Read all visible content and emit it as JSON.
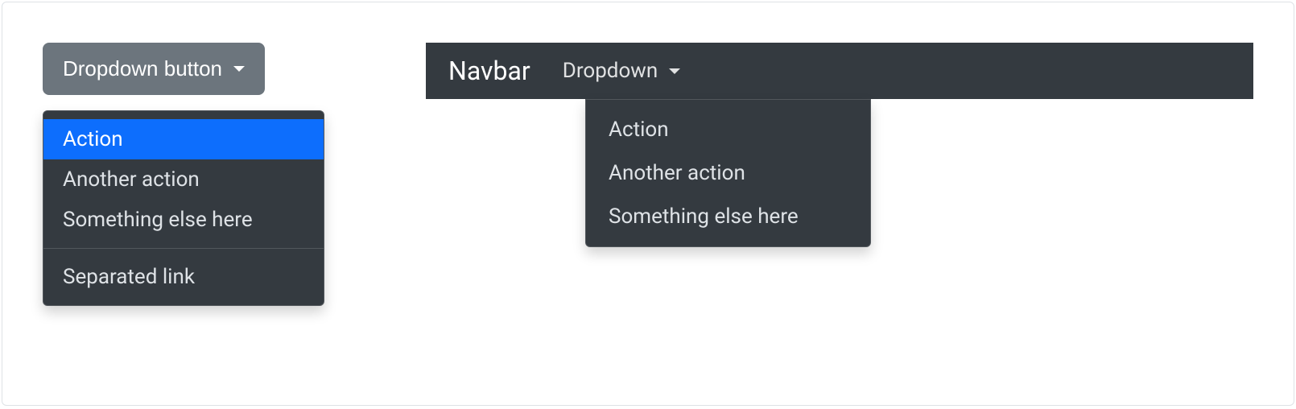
{
  "left": {
    "button_label": "Dropdown button",
    "menu": {
      "items": [
        "Action",
        "Another action",
        "Something else here"
      ],
      "separated": "Separated link",
      "active_index": 0
    }
  },
  "navbar": {
    "brand": "Navbar",
    "dropdown_label": "Dropdown",
    "menu": {
      "items": [
        "Action",
        "Another action",
        "Something else here"
      ]
    }
  }
}
